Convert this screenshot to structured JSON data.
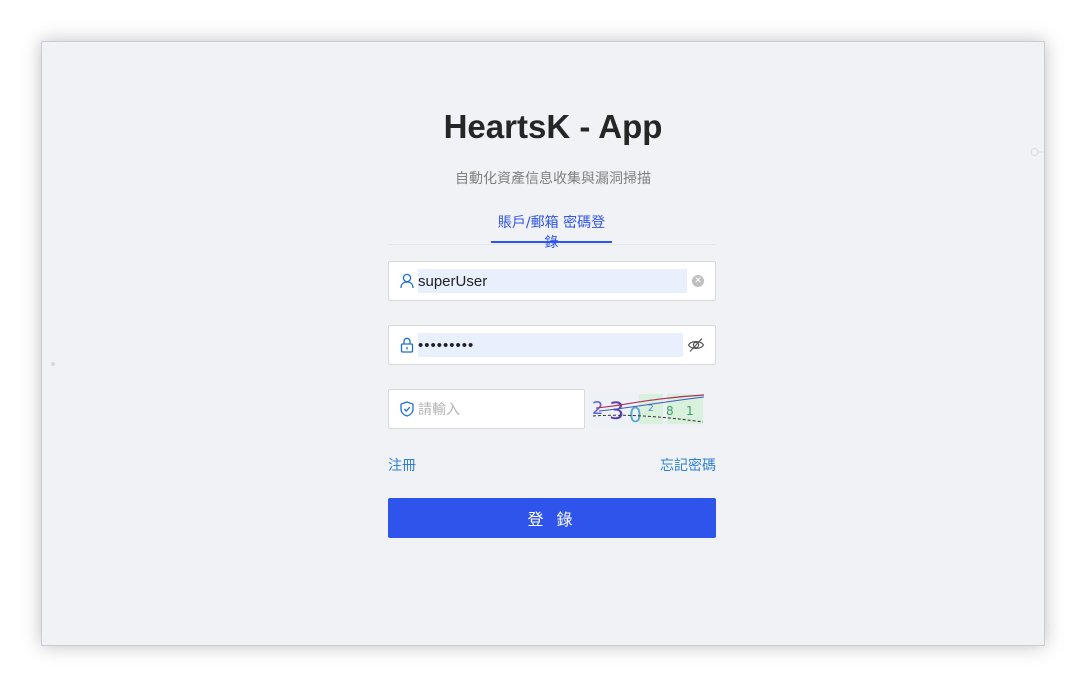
{
  "app": {
    "title": "HeartsK - App",
    "subtitle": "自動化資產信息收集與漏洞掃描"
  },
  "tabs": [
    {
      "label": "賬戶/郵箱 密碼登錄",
      "active": true
    }
  ],
  "form": {
    "username_value": "superUser",
    "password_value": "•••••••••",
    "captcha_placeholder": "請輸入",
    "captcha_image_text": "2 3 0 8 1"
  },
  "links": {
    "register": "注冊",
    "forgot": "忘記密碼"
  },
  "login_button": "登 錄",
  "colors": {
    "accent": "#2f54eb",
    "link": "#2f80d6",
    "background": "#f0f2f5",
    "autofill": "#e8f0fe"
  },
  "icons": {
    "username": "user-icon",
    "password": "lock-icon",
    "captcha": "shield-check-icon",
    "clear": "clear-icon",
    "visibility": "eye-invisible-icon"
  }
}
